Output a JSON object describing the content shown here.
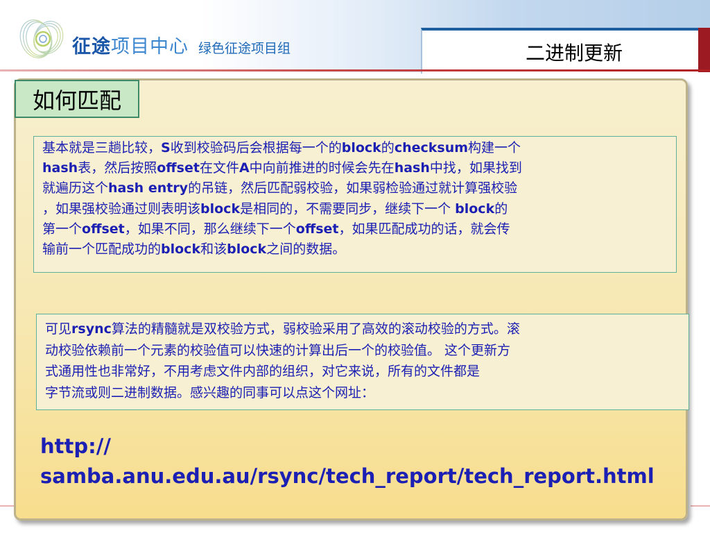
{
  "header": {
    "brand_part1": "征途",
    "brand_part2": "项目中心",
    "brand_sub": "绿色征途项目组",
    "slide_title": "二进制更新",
    "logo_icon": "interlocking-rings-logo-icon"
  },
  "colors": {
    "brand_blue": "#1f6ab8",
    "body_text": "#1b1fb3",
    "label_green": "#c9e8c6",
    "accent_red": "#9c1b22",
    "panel_yellow": "#f7e8b2"
  },
  "section": {
    "label": "如何匹配"
  },
  "box1": {
    "lines": [
      [
        "基本就是三趟比较，",
        "S",
        "收到校验码后会根据每一个的",
        "block",
        "的",
        "checksum",
        "构建一个"
      ],
      [
        "",
        "hash",
        "表，然后按照",
        "offset",
        "在文件",
        "A",
        "中向前推进的时候会先在",
        "hash",
        "中找，如果找到"
      ],
      [
        "就遍历这个",
        "hash entry",
        "的吊链，然后匹配弱校验，如果弱检验通过就计算强校验"
      ],
      [
        "，如果强校验通过则表明该",
        "block",
        "是相同的，不需要同步，继续下一个 ",
        "block",
        "的"
      ],
      [
        "第一个",
        "offset",
        "，如果不同，那么继续下一个",
        "offset",
        "，如果匹配成功的话，就会传"
      ],
      [
        "输前一个匹配成功的",
        "block",
        "和该",
        "block",
        "之间的数据。"
      ]
    ]
  },
  "box2": {
    "lines": [
      [
        "可见",
        "rsync",
        "算法的精髓就是双校验方式，弱校验采用了高效的滚动校验的方式。滚"
      ],
      [
        "动校验依赖前一个元素的校验值可以快速的计算出后一个的校验值。 这个更新方"
      ],
      [
        "式通用性也非常好，不用考虑文件内部的组织，对它来说，所有的文件都是"
      ],
      [
        "字节流或则二进制数据。感兴趣的同事可以点这个网址："
      ]
    ]
  },
  "link": {
    "line1": "http://",
    "line2": "samba.anu.edu.au/rsync/tech_report/tech_report.html"
  }
}
